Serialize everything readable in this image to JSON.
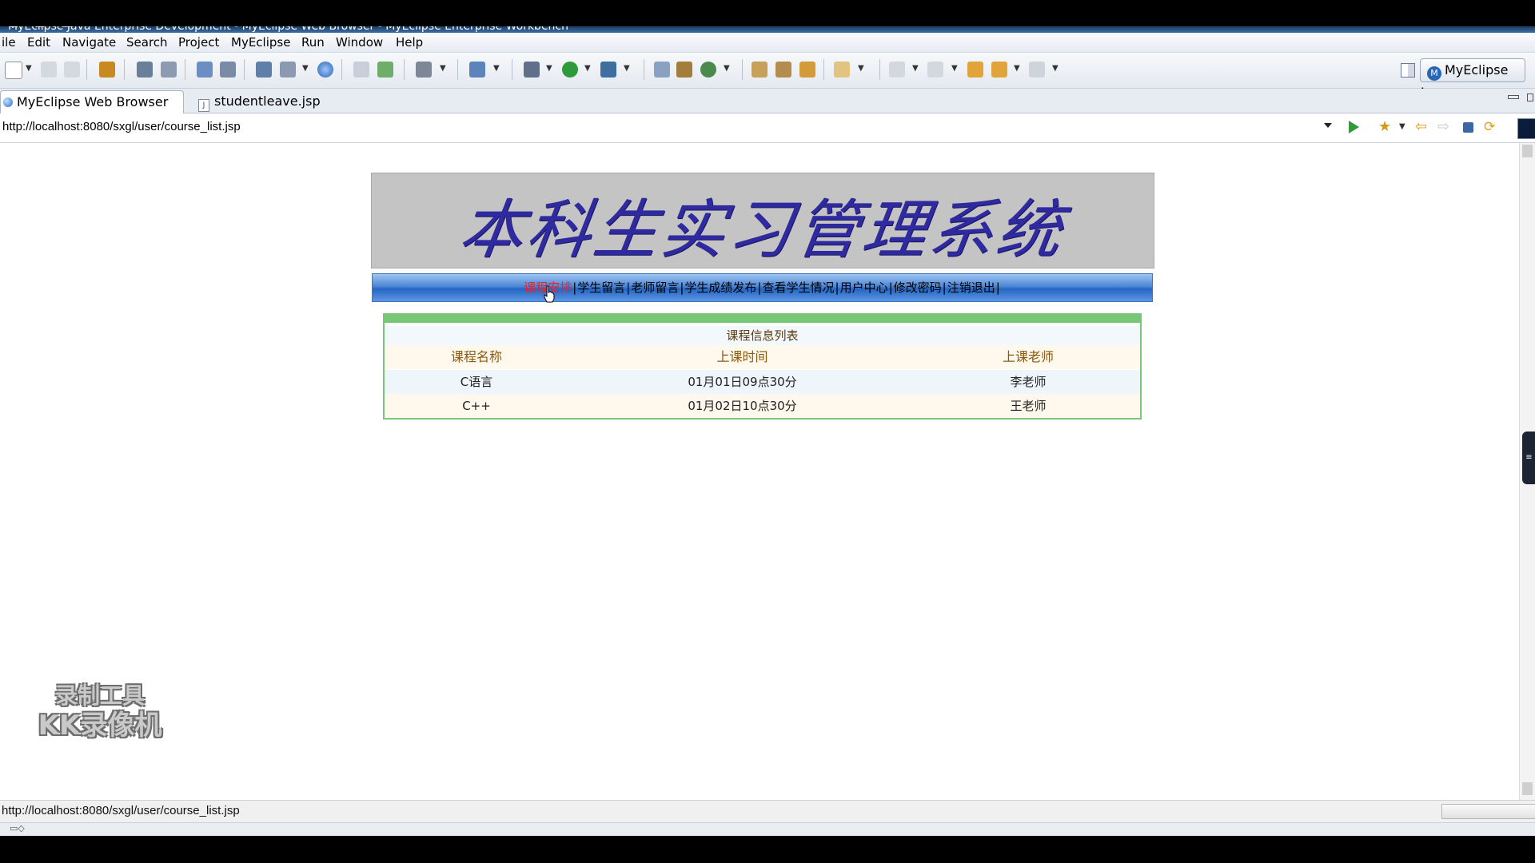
{
  "window": {
    "title": "MyEclipse Java Enterprise Development - MyEclipse Web Browser - MyEclipse Enterprise Workbench"
  },
  "menu": [
    "ile",
    "Edit",
    "Navigate",
    "Search",
    "Project",
    "MyEclipse",
    "Run",
    "Window",
    "Help"
  ],
  "toolbar": {
    "perspective_label": "MyEclipse J..."
  },
  "tabs": [
    {
      "label": "MyEclipse Web Browser",
      "icon": "globe-icon",
      "active": true
    },
    {
      "label": "studentleave.jsp",
      "icon": "jsp-file-icon",
      "active": false
    }
  ],
  "browser": {
    "url": "http://localhost:8080/sxgl/user/course_list.jsp",
    "status_url": "http://localhost:8080/sxgl/user/course_list.jsp"
  },
  "page": {
    "banner_title": "本科生实习管理系统",
    "nav": [
      {
        "label": "课程安排",
        "current": true
      },
      {
        "label": "学生留言",
        "current": false
      },
      {
        "label": "老师留言",
        "current": false
      },
      {
        "label": "学生成绩发布",
        "current": false
      },
      {
        "label": "查看学生情况",
        "current": false
      },
      {
        "label": "用户中心",
        "current": false
      },
      {
        "label": "修改密码",
        "current": false
      },
      {
        "label": "注销退出",
        "current": false
      }
    ],
    "nav_separator": "|",
    "table": {
      "caption": "课程信息列表",
      "headers": [
        "课程名称",
        "上课时间",
        "上课老师"
      ],
      "rows": [
        [
          "C语言",
          "01月01日09点30分",
          "李老师"
        ],
        [
          "C++",
          "01月02日10点30分",
          "王老师"
        ]
      ]
    }
  },
  "watermark": {
    "line1": "录制工具",
    "line2": "KK录像机"
  },
  "colors": {
    "banner_text": "#2f2aa0",
    "nav_current": "#ff1a1a",
    "panel_border": "#7cc47c"
  }
}
